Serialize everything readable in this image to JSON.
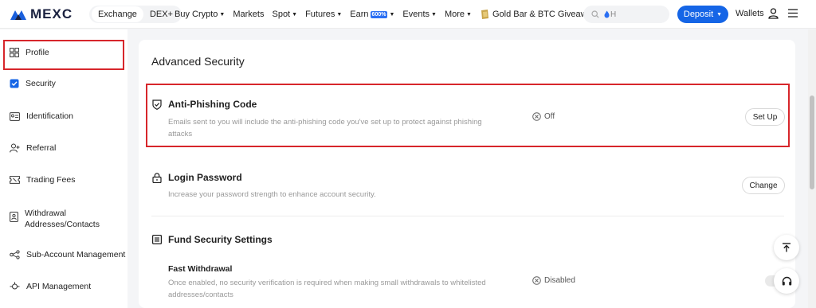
{
  "header": {
    "brand": "MEXC",
    "segments": [
      "Exchange",
      "DEX+"
    ],
    "nav": [
      {
        "label": "Buy Crypto",
        "caret": true
      },
      {
        "label": "Markets",
        "caret": false
      },
      {
        "label": "Spot",
        "caret": true
      },
      {
        "label": "Futures",
        "caret": true
      },
      {
        "label": "Earn",
        "caret": true,
        "badge": "600%"
      },
      {
        "label": "Events",
        "caret": true
      },
      {
        "label": "More",
        "caret": true
      }
    ],
    "promo": "Gold Bar & BTC Giveaway",
    "search_placeholder": "H",
    "deposit_label": "Deposit",
    "wallets_label": "Wallets"
  },
  "sidebar": {
    "items": [
      {
        "label": "Profile",
        "icon": "profile-icon"
      },
      {
        "label": "Security",
        "icon": "shield-check-icon",
        "active": true
      },
      {
        "label": "Identification",
        "icon": "id-card-icon"
      },
      {
        "label": "Referral",
        "icon": "add-user-icon"
      },
      {
        "label": "Trading Fees",
        "icon": "ticket-icon"
      },
      {
        "label": "Withdrawal\nAddresses/Contacts",
        "line1": "Withdrawal",
        "line2": "Addresses/Contacts",
        "icon": "address-book-icon"
      },
      {
        "label": "Sub-Account Management",
        "icon": "sub-account-icon"
      },
      {
        "label": "API Management",
        "icon": "api-icon"
      }
    ]
  },
  "main": {
    "title": "Advanced Security",
    "anti_phishing": {
      "title": "Anti-Phishing Code",
      "desc_line1": "Emails sent to you will include the anti-phishing code you've set up to protect against phishing",
      "desc_line2": "attacks",
      "status": "Off",
      "action": "Set Up"
    },
    "login_password": {
      "title": "Login Password",
      "desc": "Increase your password strength to enhance account security.",
      "action": "Change"
    },
    "fund_security": {
      "title": "Fund Security Settings",
      "fast_withdrawal": {
        "title": "Fast Withdrawal",
        "desc_line1": "Once enabled, no security verification is required when making small withdrawals to whitelisted",
        "desc_line2": "addresses/contacts",
        "status": "Disabled"
      }
    }
  },
  "colors": {
    "accent": "#1565e6",
    "highlight": "#d7262b",
    "badge": "#2a6ff3"
  }
}
